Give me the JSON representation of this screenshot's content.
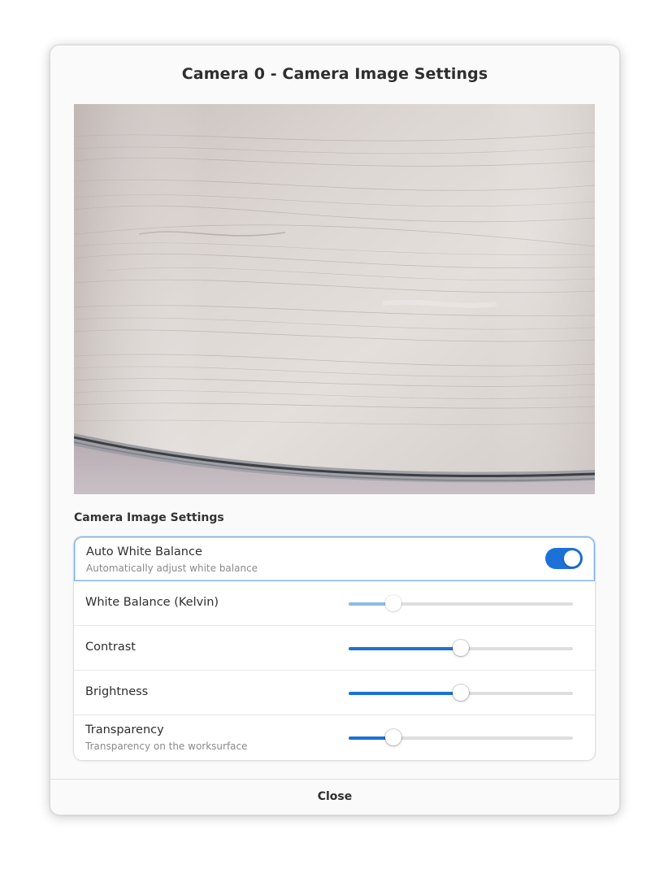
{
  "dialog": {
    "title": "Camera 0 - Camera Image Settings",
    "close_label": "Close"
  },
  "preview": {
    "icon": "camera-preview-image"
  },
  "settings": {
    "section_title": "Camera Image Settings",
    "auto_white_balance": {
      "label": "Auto White Balance",
      "subtitle": "Automatically adjust white balance",
      "enabled": true
    },
    "white_balance": {
      "label": "White Balance (Kelvin)",
      "value_fraction": 0.2,
      "disabled": true
    },
    "contrast": {
      "label": "Contrast",
      "value_fraction": 0.5
    },
    "brightness": {
      "label": "Brightness",
      "value_fraction": 0.5
    },
    "transparency": {
      "label": "Transparency",
      "subtitle": "Transparency on the worksurface",
      "value_fraction": 0.2
    }
  },
  "colors": {
    "accent": "#1c71d8",
    "accent_disabled": "#8db9ec",
    "focus_ring": "#78aeed",
    "dialog_bg": "#fafafa"
  }
}
